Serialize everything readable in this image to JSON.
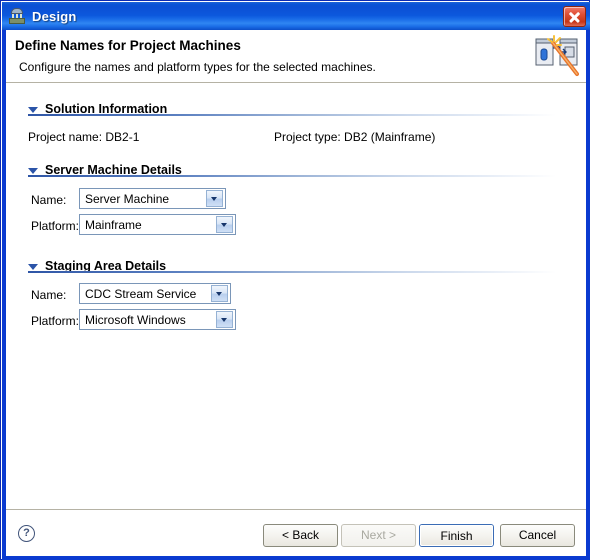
{
  "window": {
    "title": "Design",
    "icon": "building-icon",
    "close_label": "Close",
    "close_icon": "close-icon"
  },
  "header": {
    "title": "Define Names for Project Machines",
    "subtitle": "Configure the names and platform types for the selected  machines.",
    "icon": "wizard-wand-icon"
  },
  "sections": {
    "solution": {
      "label": "Solution Information",
      "toggle_icon": "triangle-down-icon",
      "project_name_text": "Project name: DB2-1",
      "project_type_text": "Project type: DB2 (Mainframe)"
    },
    "server": {
      "label": "Server Machine Details",
      "toggle_icon": "triangle-down-icon",
      "name_label": "Name:",
      "name_value": "Server Machine",
      "platform_label": "Platform:",
      "platform_value": "Mainframe"
    },
    "staging": {
      "label": "Staging Area Details",
      "toggle_icon": "triangle-down-icon",
      "name_label": "Name:",
      "name_value": "CDC Stream Service",
      "platform_label": "Platform:",
      "platform_value": "Microsoft Windows"
    }
  },
  "footer": {
    "help_label": "?",
    "back_label": "< Back",
    "next_label": "Next >",
    "finish_label": "Finish",
    "cancel_label": "Cancel"
  },
  "colors": {
    "title_bar_blue": "#0b4fd4",
    "frame_blue": "#0a3ad0",
    "section_accent": "#2e55a6",
    "close_red": "#c53618"
  }
}
